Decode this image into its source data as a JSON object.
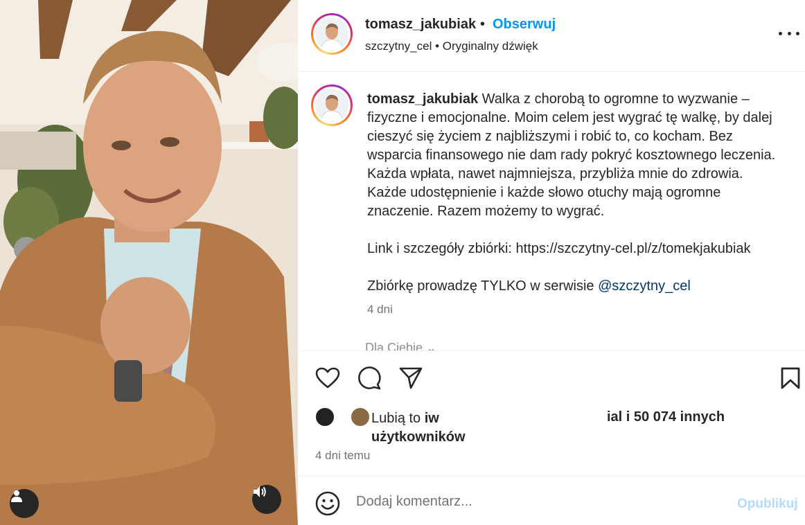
{
  "post": {
    "header": {
      "username": "tomasz_jakubiak",
      "separator": "•",
      "follow_label": "Obserwuj",
      "subtitle": "szczytny_cel • Oryginalny dźwięk"
    },
    "caption": {
      "username": "tomasz_jakubiak",
      "text": "Walka z chorobą to ogromne to wyzwanie – fizyczne i emocjonalne. Moim celem jest wygrać tę walkę, by dalej cieszyć się życiem z najbliższymi i robić to, co kocham. Bez wsparcia finansowego nie dam rady pokryć kosztownego leczenia. Każda wpłata, nawet najmniejsza, przybliża mnie do zdrowia. Każde udostępnienie i każde słowo otuchy mają ogromne znaczenie. Razem możemy to wygrać.",
      "link_line": "Link i szczegóły zbiórki: https://szczytny-cel.pl/z/tomekjakubiak",
      "service_line_prefix": "Zbiórkę prowadzę TYLKO w serwisie ",
      "service_mention": "@szczytny_cel",
      "time": "4 dni",
      "for_you": "Dla Ciebie ⌄"
    },
    "likes": {
      "prefix": "Lubią to ",
      "bold_start": "iw",
      "line2": "użytkowników",
      "bold_end": "ial i 50 074 innych"
    },
    "posted_time": "4 dni temu",
    "comment": {
      "placeholder": "Dodaj komentarz...",
      "publish_label": "Opublikuj"
    }
  },
  "icons": {
    "heart": "heart-icon",
    "comment": "comment-icon",
    "share": "share-icon",
    "bookmark": "bookmark-icon",
    "emoji": "emoji-icon",
    "user_tag": "user-tag-icon",
    "sound": "sound-icon",
    "more": "more-options-icon"
  },
  "colors": {
    "accent": "#0095f6",
    "mention": "#00376b",
    "muted": "#737373",
    "publish_disabled": "#b3dbff"
  }
}
